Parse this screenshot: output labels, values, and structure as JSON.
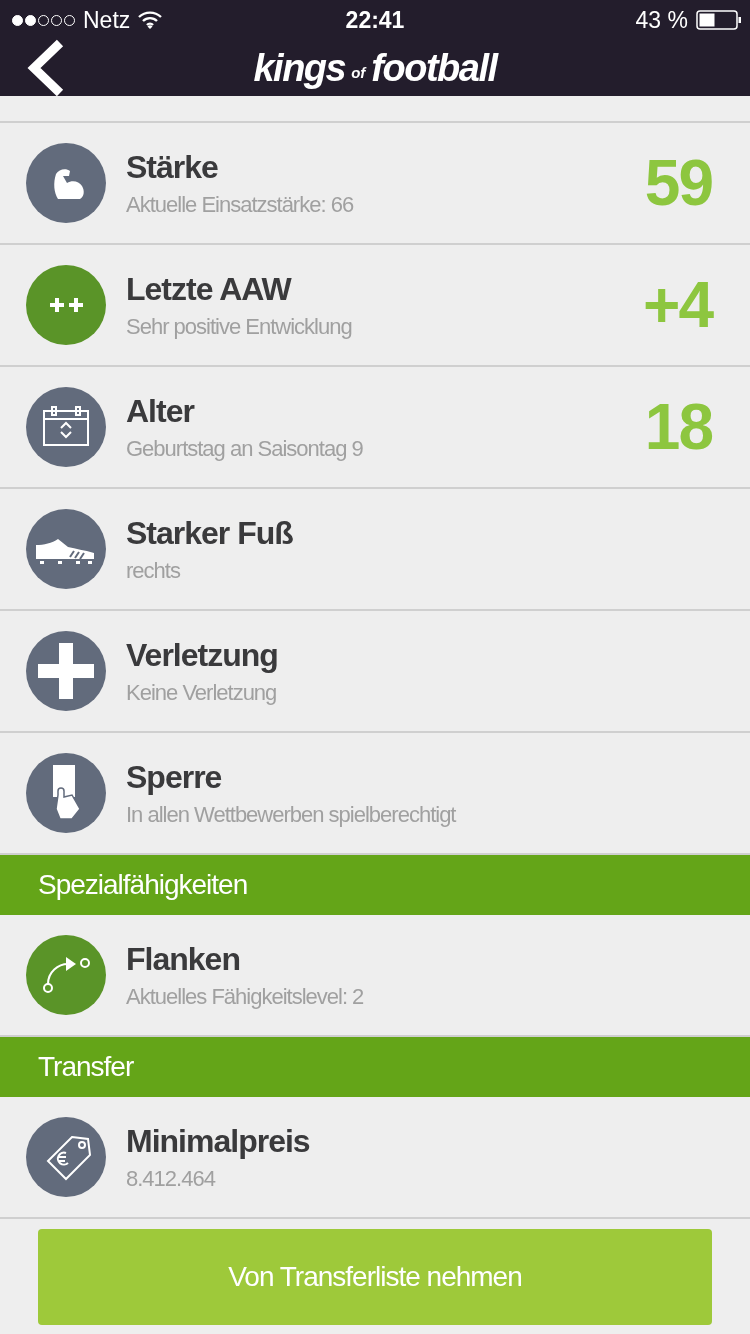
{
  "status_bar": {
    "carrier": "Netz",
    "time": "22:41",
    "battery": "43 %"
  },
  "header": {
    "logo": {
      "word_1": "kings",
      "small": "of",
      "word_2": "football"
    }
  },
  "sections": [
    {
      "rows": [
        {
          "title": "Stärke",
          "subtitle": "Aktuelle Einsatzstärke: 66",
          "value": "59",
          "color": "#626b7c"
        },
        {
          "title": "Letzte AAW",
          "subtitle": "Sehr positive Entwicklung",
          "value": "+4",
          "color": "#5a9428"
        },
        {
          "title": "Alter",
          "subtitle": "Geburtstag an Saisontag 9",
          "value": "18",
          "color": "#626b7c"
        },
        {
          "title": "Starker Fuß",
          "subtitle": "rechts",
          "color": "#626b7c"
        },
        {
          "title": "Verletzung",
          "subtitle": "Keine Verletzung",
          "color": "#626b7c"
        },
        {
          "title": "Sperre",
          "subtitle": "In allen Wettbewerben spielberechtigt",
          "color": "#626b7c"
        }
      ]
    },
    {
      "title": "Spezialfähigkeiten",
      "rows": [
        {
          "title": "Flanken",
          "subtitle": "Aktuelles Fähigkeitslevel: 2",
          "color": "#5a9428"
        }
      ]
    },
    {
      "title": "Transfer",
      "rows": [
        {
          "title": "Minimalpreis",
          "subtitle": "8.412.464",
          "color": "#626b7c"
        }
      ]
    }
  ],
  "button": {
    "label": "Von Transferliste nehmen"
  }
}
